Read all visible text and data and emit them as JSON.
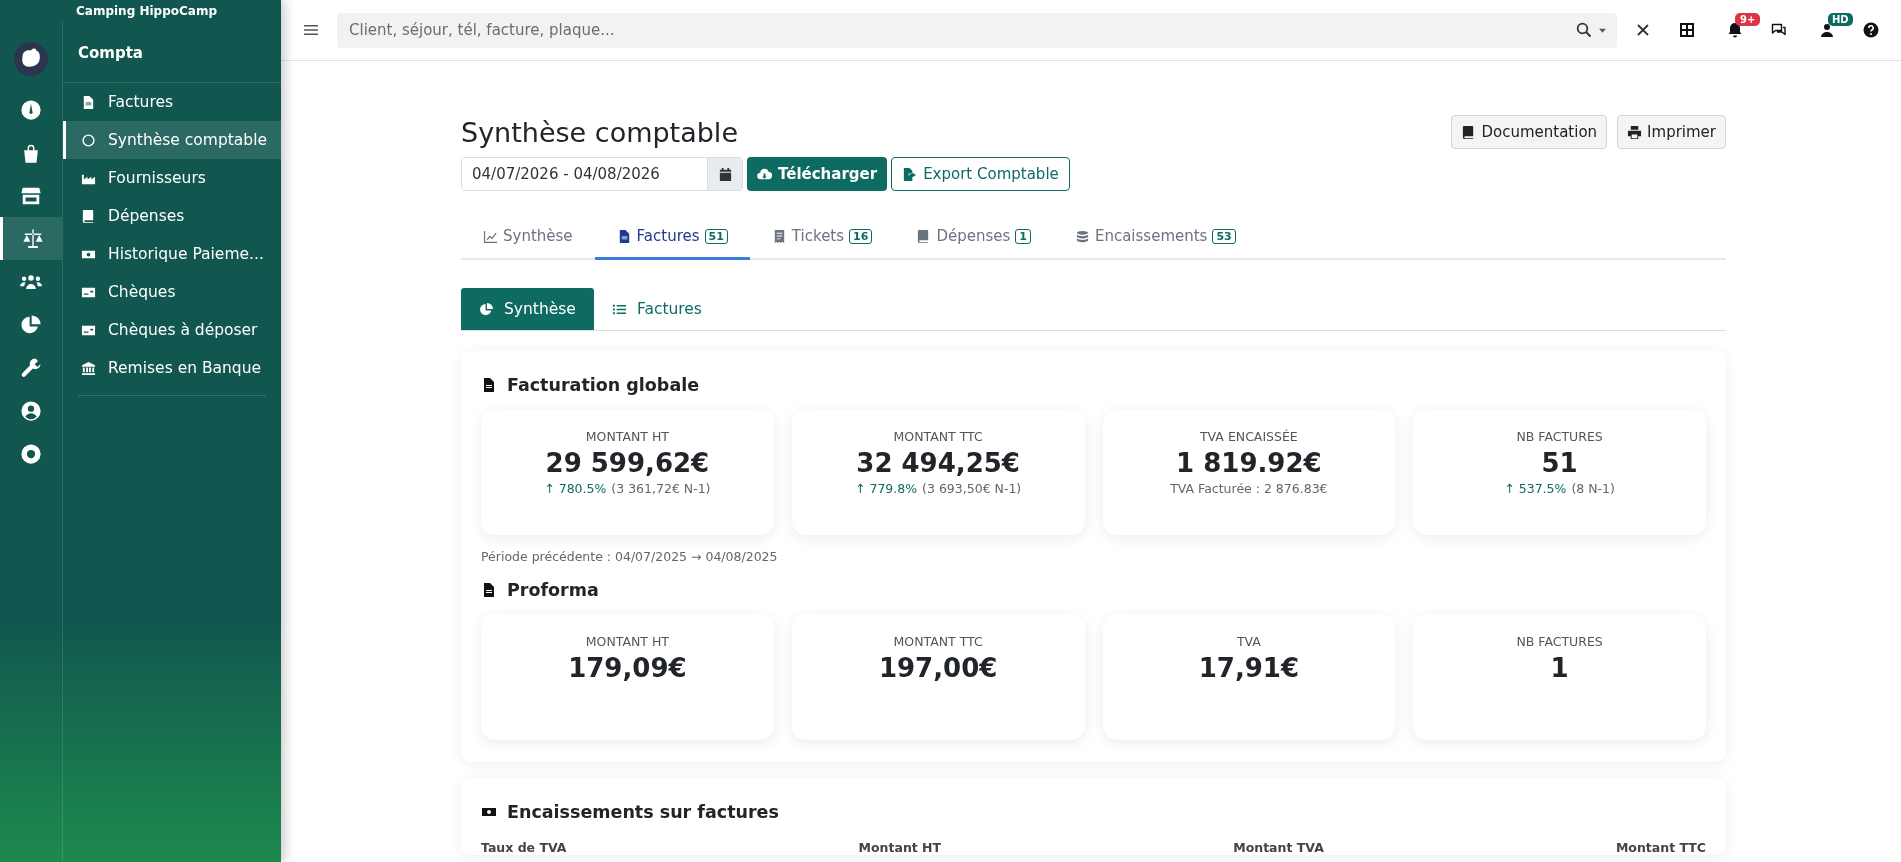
{
  "sidebar": {
    "org": "Camping HippoCamp",
    "section_title": "Compta",
    "rail": [
      {
        "selected": false
      },
      {
        "selected": false
      },
      {
        "selected": false
      },
      {
        "selected": true
      },
      {
        "selected": false
      },
      {
        "selected": false
      },
      {
        "selected": false
      },
      {
        "selected": false
      },
      {
        "selected": false
      }
    ],
    "items": [
      {
        "label": "Factures",
        "selected": false
      },
      {
        "label": "Synthèse comptable",
        "selected": true
      },
      {
        "label": "Fournisseurs",
        "selected": false
      },
      {
        "label": "Dépenses",
        "selected": false
      },
      {
        "label": "Historique Paieme...",
        "selected": false
      },
      {
        "label": "Chèques",
        "selected": false
      },
      {
        "label": "Chèques à déposer",
        "selected": false
      },
      {
        "label": "Remises en Banque",
        "selected": false
      }
    ]
  },
  "topbar": {
    "search": {
      "placeholder": "Client, séjour, tél, facture, plaque..."
    },
    "notification_badge": "9+",
    "user_badge": "HD"
  },
  "page": {
    "title": "Synthèse comptable",
    "buttons": [
      "Documentation",
      "Imprimer"
    ],
    "date_range": "04/07/2026 - 04/08/2026",
    "download_button": "Télécharger",
    "export_button": "Export Comptable"
  },
  "tabs": [
    {
      "label": "Synthèse",
      "selected": false
    },
    {
      "label": "Factures",
      "count": "51",
      "selected": true
    },
    {
      "label": "Tickets",
      "count": "16",
      "selected": false
    },
    {
      "label": "Dépenses",
      "count": "1",
      "selected": false
    },
    {
      "label": "Encaissements",
      "count": "53",
      "selected": false
    }
  ],
  "subtabs": [
    {
      "label": "Synthèse",
      "selected": true
    },
    {
      "label": "Factures",
      "selected": false
    }
  ],
  "sections": [
    {
      "title": "Facturation globale",
      "cards": [
        {
          "label": "MONTANT HT",
          "value": "29 599,62€",
          "change": "↑ 780.5%",
          "previous": "(3 361,72€ N-1)"
        },
        {
          "label": "MONTANT TTC",
          "value": "32 494,25€",
          "change": "↑ 779.8%",
          "previous": "(3 693,50€ N-1)"
        },
        {
          "label": "TVA ENCAISSÉE",
          "value": "1 819.92€",
          "detail": "TVA Facturée : 2 876.83€"
        },
        {
          "label": "NB FACTURES",
          "value": "51",
          "change": "↑ 537.5%",
          "previous": "(8 N-1)"
        }
      ],
      "note": "Période précédente : 04/07/2025 → 04/08/2025"
    },
    {
      "title": "Proforma",
      "cards": [
        {
          "label": "MONTANT HT",
          "value": "179,09€"
        },
        {
          "label": "MONTANT TTC",
          "value": "197,00€"
        },
        {
          "label": "TVA",
          "value": "17,91€"
        },
        {
          "label": "NB FACTURES",
          "value": "1"
        }
      ]
    }
  ],
  "payments": {
    "title": "Encaissements sur factures",
    "columns": [
      "Taux de TVA",
      "Montant HT",
      "Montant TVA",
      "Montant TTC"
    ]
  }
}
